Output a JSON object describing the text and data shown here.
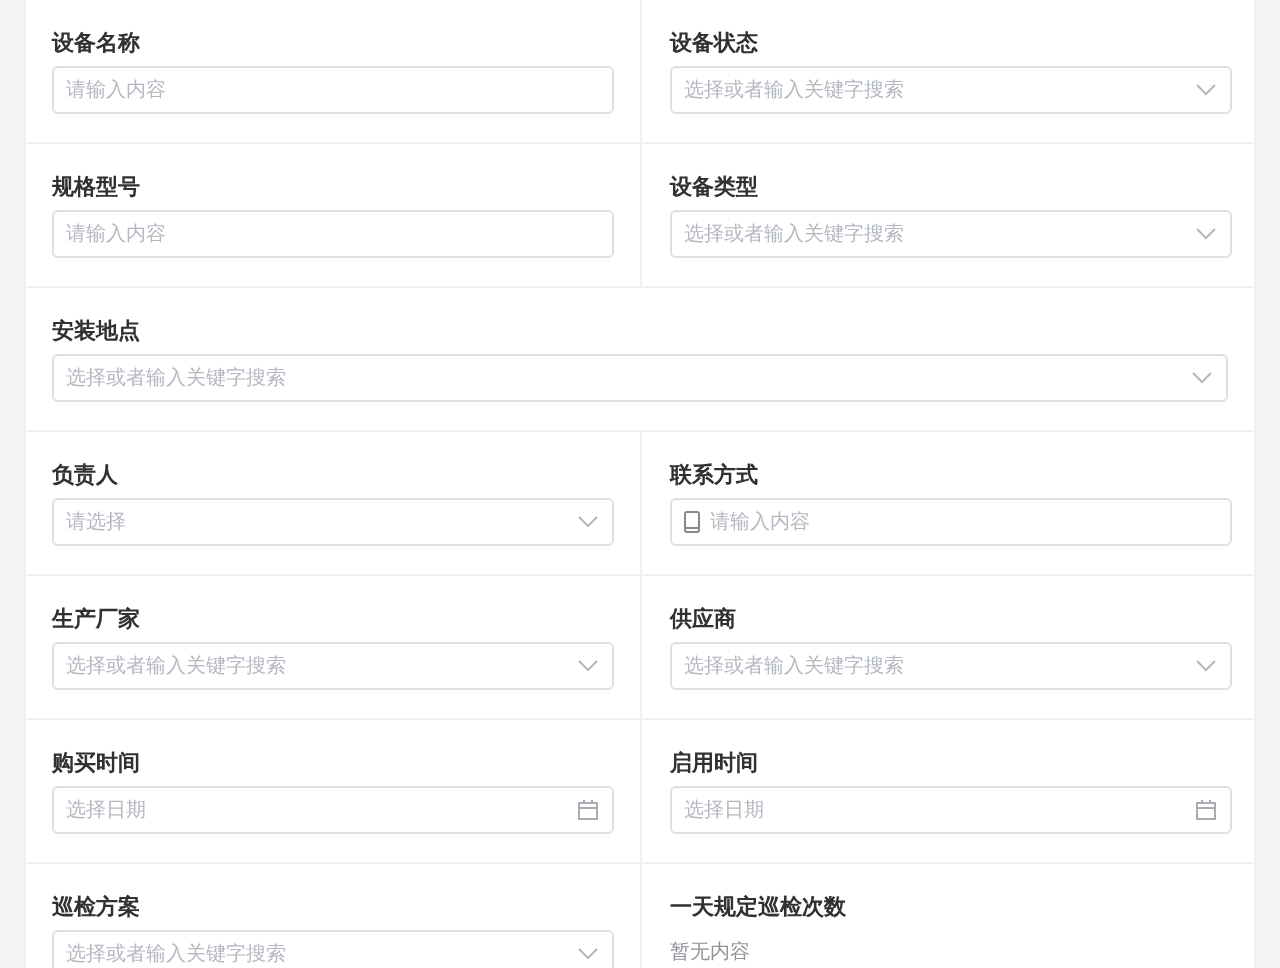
{
  "rows": [
    {
      "fields": [
        {
          "label": "设备名称",
          "kind": "text",
          "placeholder": "请输入内容"
        },
        {
          "label": "设备状态",
          "kind": "select",
          "placeholder": "选择或者输入关键字搜索"
        }
      ]
    },
    {
      "fields": [
        {
          "label": "规格型号",
          "kind": "text",
          "placeholder": "请输入内容"
        },
        {
          "label": "设备类型",
          "kind": "select",
          "placeholder": "选择或者输入关键字搜索"
        }
      ]
    },
    {
      "fields": [
        {
          "label": "安装地点",
          "kind": "select",
          "placeholder": "选择或者输入关键字搜索"
        }
      ]
    },
    {
      "fields": [
        {
          "label": "负责人",
          "kind": "select",
          "placeholder": "请选择"
        },
        {
          "label": "联系方式",
          "kind": "phone",
          "placeholder": "请输入内容"
        }
      ]
    },
    {
      "fields": [
        {
          "label": "生产厂家",
          "kind": "select",
          "placeholder": "选择或者输入关键字搜索"
        },
        {
          "label": "供应商",
          "kind": "select",
          "placeholder": "选择或者输入关键字搜索"
        }
      ]
    },
    {
      "fields": [
        {
          "label": "购买时间",
          "kind": "date",
          "placeholder": "选择日期"
        },
        {
          "label": "启用时间",
          "kind": "date",
          "placeholder": "选择日期"
        }
      ]
    },
    {
      "fields": [
        {
          "label": "巡检方案",
          "kind": "select",
          "placeholder": "选择或者输入关键字搜索"
        },
        {
          "label": "一天规定巡检次数",
          "kind": "empty",
          "value": "暂无内容"
        }
      ]
    }
  ]
}
